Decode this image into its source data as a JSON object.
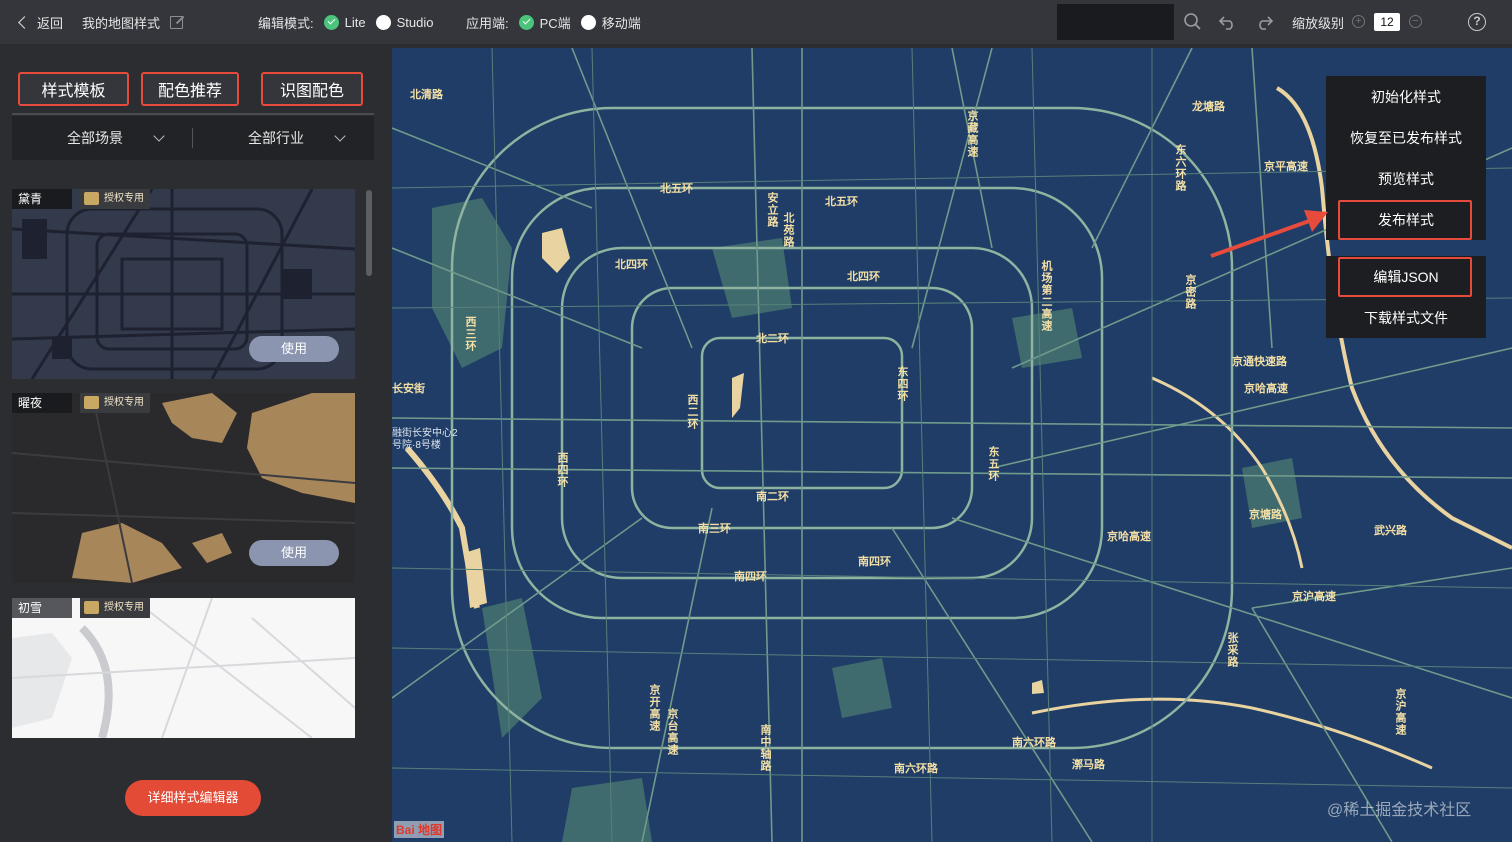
{
  "topbar": {
    "back_label": "返回",
    "title": "我的地图样式",
    "edit_mode_label": "编辑模式:",
    "mode_lite": "Lite",
    "mode_studio": "Studio",
    "platform_label": "应用端:",
    "platform_pc": "PC端",
    "platform_mobile": "移动端",
    "zoom_label": "缩放级别",
    "zoom_value": "12",
    "active_color": "#4cc47c"
  },
  "sidebar": {
    "tabs": [
      "样式模板",
      "配色推荐",
      "识图配色"
    ],
    "filters": [
      "全部场景",
      "全部行业"
    ],
    "cards": [
      {
        "name": "黛青",
        "badge": "授权专用",
        "action": "使用"
      },
      {
        "name": "曜夜",
        "badge": "授权专用",
        "action": "使用"
      },
      {
        "name": "初雪",
        "badge": "授权专用",
        "action": ""
      }
    ],
    "detail_editor": "详细样式编辑器"
  },
  "menu": {
    "items": [
      "初始化样式",
      "恢复至已发布样式",
      "预览样式",
      "发布样式"
    ],
    "items2": [
      "编辑JSON",
      "下载样式文件"
    ],
    "highlight_color": "#e64b3c"
  },
  "map": {
    "background": "#1f3d66",
    "labels": [
      {
        "text": "北清路"
      },
      {
        "text": "北五环"
      },
      {
        "text": "北五环"
      },
      {
        "text": "北四环"
      },
      {
        "text": "北二环"
      },
      {
        "text": "南二环"
      },
      {
        "text": "南三环"
      },
      {
        "text": "南四环"
      },
      {
        "text": "南四环"
      },
      {
        "text": "南六环路"
      },
      {
        "text": "京平高速"
      },
      {
        "text": "龙塘路"
      },
      {
        "text": "京通快速路"
      },
      {
        "text": "京哈高速"
      },
      {
        "text": "京塘路"
      },
      {
        "text": "武兴路"
      },
      {
        "text": "京沪高速"
      },
      {
        "text": "南六环路"
      },
      {
        "text": "漷马路"
      },
      {
        "text": "京哈高速"
      },
      {
        "text": "北四环"
      },
      {
        "text": "长安街"
      }
    ],
    "vlabels": [
      {
        "text": "京藏高速"
      },
      {
        "text": "安立路"
      },
      {
        "text": "北苑路"
      },
      {
        "text": "西三环"
      },
      {
        "text": "西二环"
      },
      {
        "text": "西四环"
      },
      {
        "text": "东四环"
      },
      {
        "text": "东五环"
      },
      {
        "text": "机场第二高速"
      },
      {
        "text": "东六环路"
      },
      {
        "text": "京开高速"
      },
      {
        "text": "京台高速"
      },
      {
        "text": "南中轴路"
      },
      {
        "text": "张采路"
      },
      {
        "text": "京沪高速"
      },
      {
        "text": "京密路"
      }
    ],
    "poi_text": "融街长安中心2号院·8号楼",
    "watermark": "@稀土掘金技术社区",
    "logo": "Bai 地图"
  }
}
